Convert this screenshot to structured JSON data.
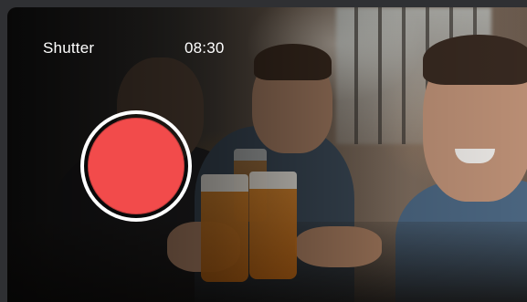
{
  "camera": {
    "mode_label": "Shutter",
    "timer": "08:30",
    "shutter_color": "#f24b4b"
  },
  "background": {
    "description_icon": "photo-background"
  }
}
